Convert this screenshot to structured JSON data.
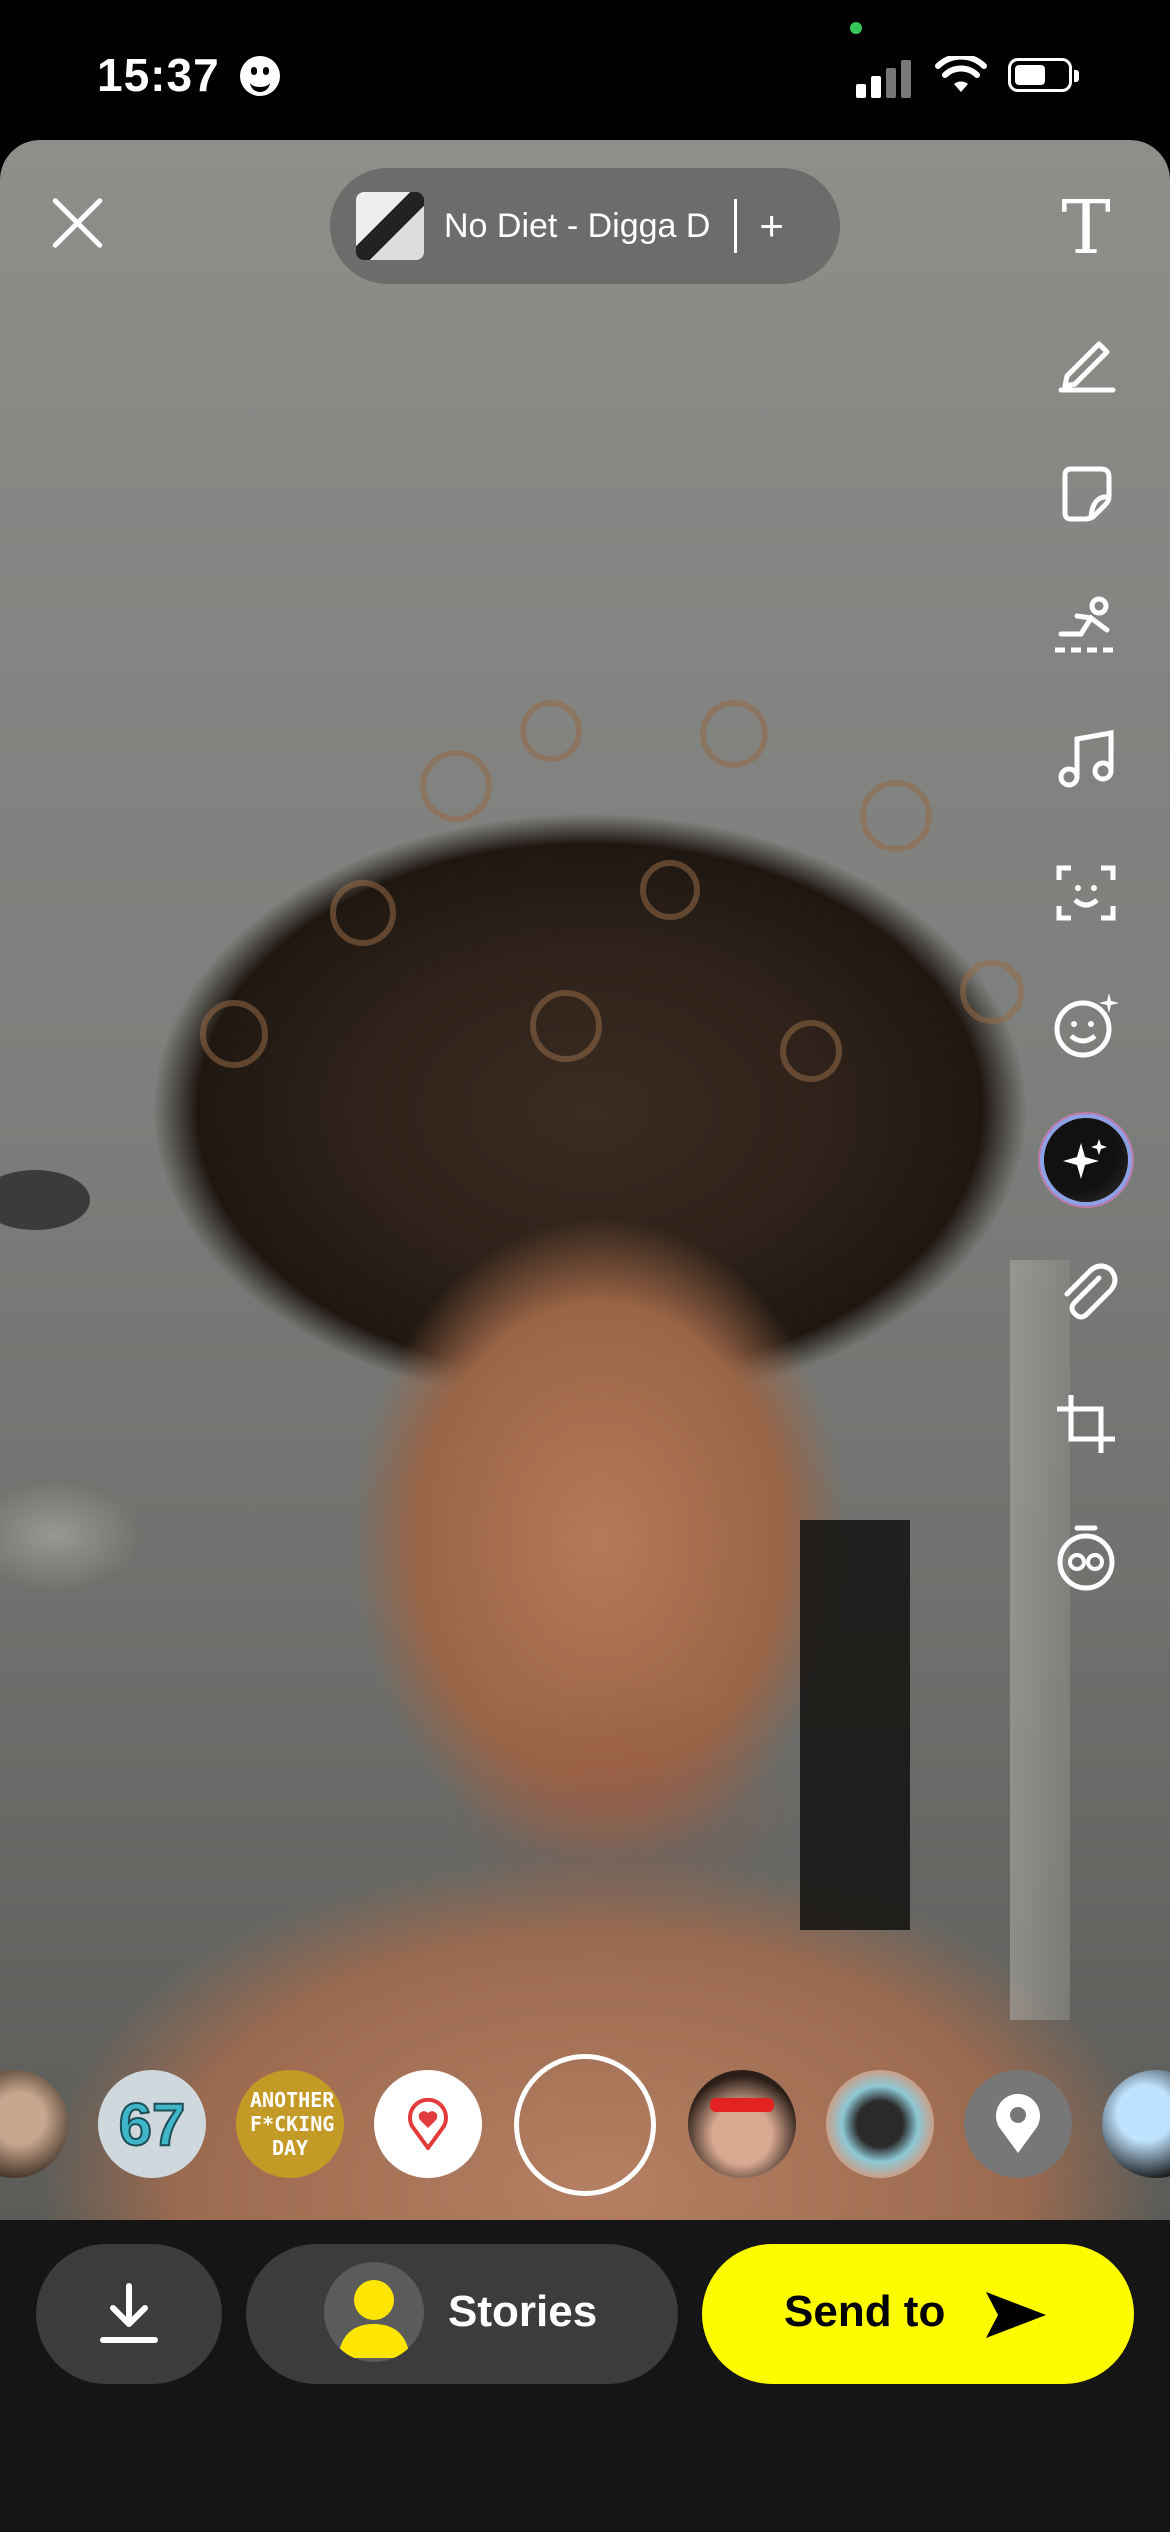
{
  "status_bar": {
    "time": "15:37"
  },
  "music": {
    "song": "No Diet - Digga D",
    "add": "+"
  },
  "tools": [
    {
      "name": "text",
      "icon": "text-icon"
    },
    {
      "name": "draw",
      "icon": "pencil-icon"
    },
    {
      "name": "sticker",
      "icon": "sticker-icon"
    },
    {
      "name": "scissors",
      "icon": "cutout-icon"
    },
    {
      "name": "music",
      "icon": "music-note-icon"
    },
    {
      "name": "scan",
      "icon": "face-scan-icon"
    },
    {
      "name": "lens",
      "icon": "smiley-sparkle-icon"
    },
    {
      "name": "ai",
      "icon": "sparkle-icon"
    },
    {
      "name": "attach",
      "icon": "paperclip-icon"
    },
    {
      "name": "crop",
      "icon": "crop-icon"
    },
    {
      "name": "timer",
      "icon": "timer-icon"
    }
  ],
  "lenses": [
    {
      "label": ""
    },
    {
      "label": "67"
    },
    {
      "label": "ANOTHER F*CKING DAY"
    },
    {
      "label": ""
    },
    {
      "label": ""
    },
    {
      "label": ""
    },
    {
      "label": ""
    },
    {
      "label": ""
    }
  ],
  "bottom_bar": {
    "stories_label": "Stories",
    "send_label": "Send to"
  },
  "colors": {
    "accent_yellow": "#fffc00",
    "button_gray": "#3c3c3c"
  }
}
